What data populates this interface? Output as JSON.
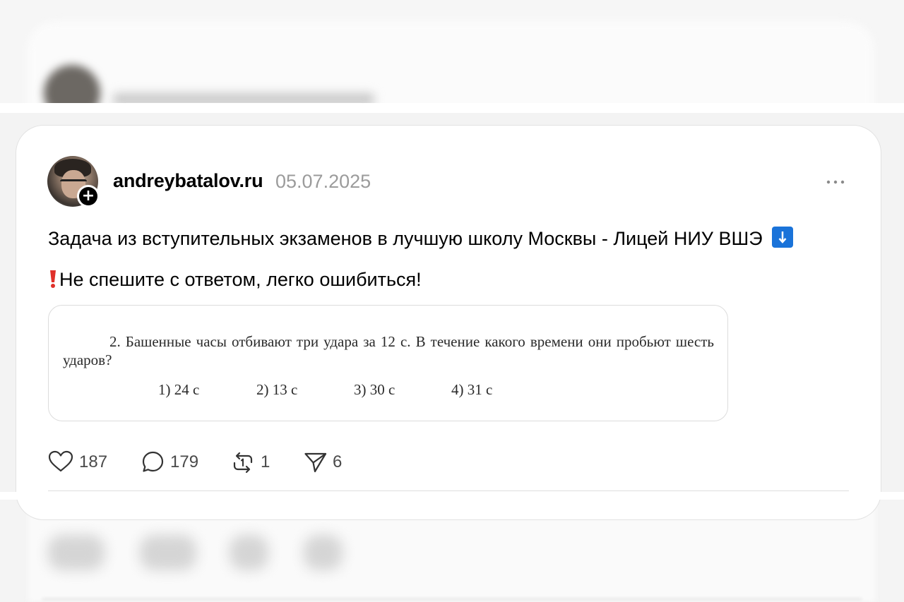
{
  "post": {
    "username": "andreybatalov.ru",
    "date": "05.07.2025",
    "more_label": "•••",
    "follow_label": "+",
    "text_line1": "Задача из вступительных экзаменов в лучшую школу Москвы - Лицей НИУ ВШЭ",
    "text_line2": "Не спешите с ответом, легко ошибиться!",
    "emoji_down": "arrow-down-icon",
    "emoji_exclamation": "exclamation-icon"
  },
  "task_image": {
    "problem": "2. Башенные часы отбивают три удара за 12 с. В течение какого времени они пробьют шесть ударов?",
    "options": [
      "1) 24 с",
      "2) 13 с",
      "3) 30 с",
      "4) 31 с"
    ]
  },
  "actions": {
    "likes": "187",
    "comments": "179",
    "reposts": "1",
    "shares": "6"
  }
}
